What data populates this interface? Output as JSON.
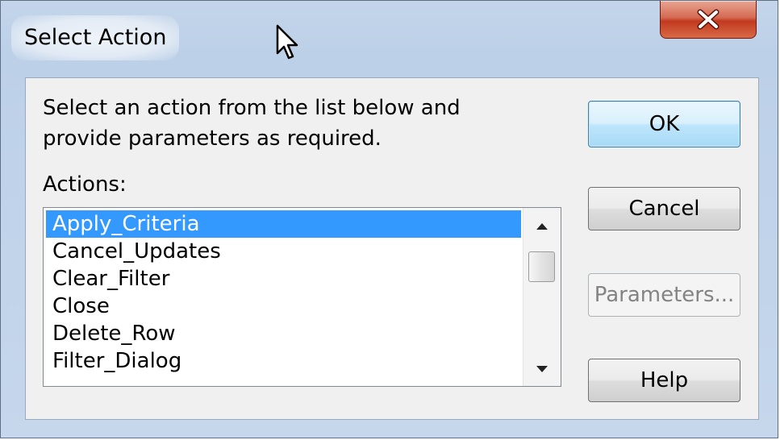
{
  "window": {
    "title": "Select Action",
    "close_icon": "close-x-icon"
  },
  "dialog": {
    "instructions": "Select an action from the list below and provide parameters as required.",
    "actions_label": "Actions:",
    "actions": [
      "Apply_Criteria",
      "Cancel_Updates",
      "Clear_Filter",
      "Close",
      "Delete_Row",
      "Filter_Dialog"
    ],
    "selected_action": "Apply_Criteria"
  },
  "buttons": {
    "ok": "OK",
    "cancel": "Cancel",
    "parameters": "Parameters...",
    "help": "Help"
  },
  "colors": {
    "selection": "#3399ff",
    "close_button": "#c1391f",
    "default_button": "#bee6fd"
  }
}
